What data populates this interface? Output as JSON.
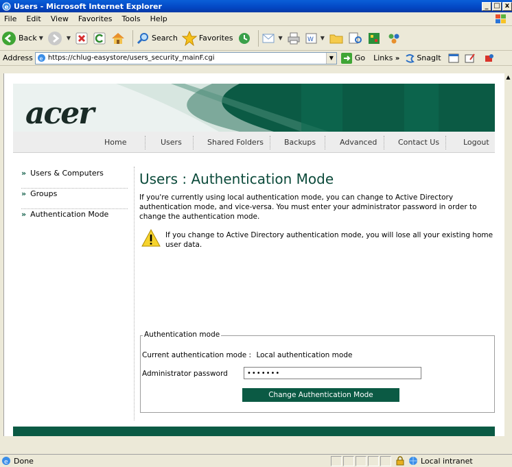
{
  "window": {
    "title": "Users - Microsoft Internet Explorer",
    "buttons": [
      "_",
      "□",
      "x"
    ]
  },
  "menu": [
    "File",
    "Edit",
    "View",
    "Favorites",
    "Tools",
    "Help"
  ],
  "toolbar": {
    "back_label": "Back",
    "search_label": "Search",
    "favorites_label": "Favorites"
  },
  "address": {
    "label": "Address",
    "url": "https://chlug-easystore/users_security_mainF.cgi",
    "go_label": "Go",
    "links_label": "Links",
    "links_more": "»",
    "snagit_label": "SnagIt"
  },
  "page": {
    "logo": "acer",
    "nav": [
      "Home",
      "Users",
      "Shared Folders",
      "Backups",
      "Advanced",
      "Contact Us",
      "Logout"
    ],
    "sidebar": [
      {
        "label": "Users & Computers"
      },
      {
        "label": "Groups"
      },
      {
        "label": "Authentication Mode"
      }
    ],
    "sidebar_bullet": "»",
    "title_section": "Users",
    "title_sep": " : ",
    "title_page": "Authentication Mode",
    "description": "If you're currently using local authentication mode, you can change to Active Directory authentication mode, and vice-versa. You must enter your administrator password in order to change the authentication mode.",
    "warning": "If you change to Active Directory authentication mode, you will lose all your existing home user data.",
    "fieldset_legend": "Authentication mode",
    "current_mode_label": "Current authentication mode :",
    "current_mode_value": "Local authentication mode",
    "password_label": "Administrator password",
    "password_colon": ":",
    "password_value": "•••••••",
    "change_button": "Change Authentication Mode"
  },
  "status": {
    "text": "Done",
    "zone": "Local intranet"
  },
  "colors": {
    "brand_green": "#0b5a44",
    "title_blue": "#0a5fd8"
  }
}
